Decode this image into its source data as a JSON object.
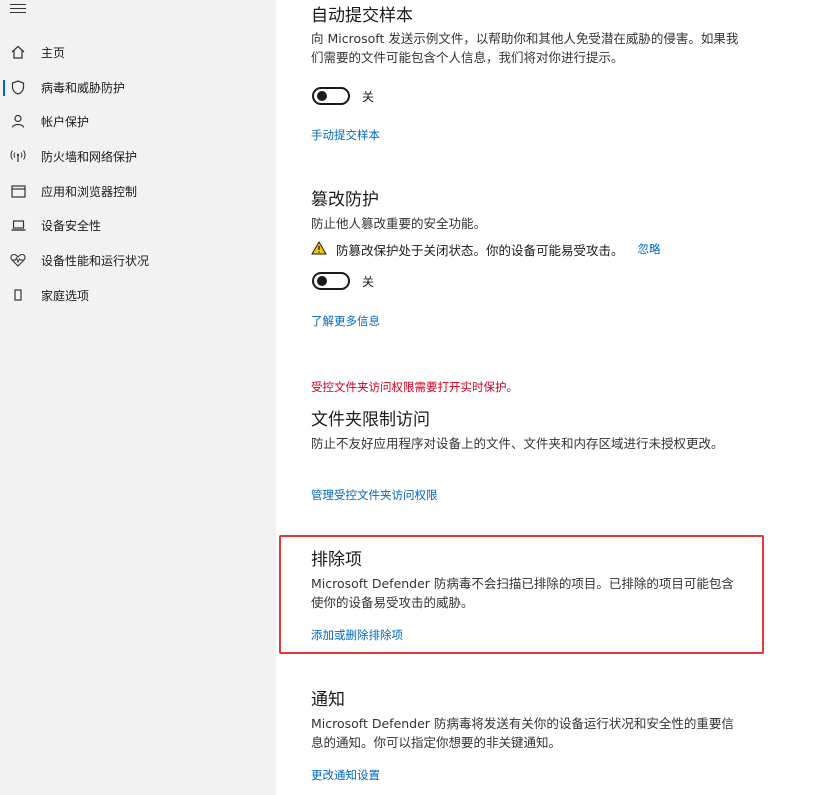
{
  "sidebar": {
    "menu_icon": "hamburger-icon",
    "items": [
      {
        "label": "主页",
        "icon": "home-icon"
      },
      {
        "label": "病毒和威胁防护",
        "icon": "shield-icon",
        "active": true
      },
      {
        "label": "帐户保护",
        "icon": "person-icon"
      },
      {
        "label": "防火墙和网络保护",
        "icon": "antenna-icon"
      },
      {
        "label": "应用和浏览器控制",
        "icon": "browser-window-icon"
      },
      {
        "label": "设备安全性",
        "icon": "laptop-icon"
      },
      {
        "label": "设备性能和运行状况",
        "icon": "heart-pulse-icon"
      },
      {
        "label": "家庭选项",
        "icon": "phone-icon"
      }
    ]
  },
  "sample_submission": {
    "title": "自动提交样本",
    "description": "向 Microsoft 发送示例文件，以帮助你和其他人免受潜在威胁的侵害。如果我们需要的文件可能包含个人信息，我们将对你进行提示。",
    "toggle_state": "关",
    "link": "手动提交样本"
  },
  "tamper_protection": {
    "title": "篡改防护",
    "description": "防止他人篡改重要的安全功能。",
    "warning_icon": "warning-triangle-icon",
    "warning_text": "防篡改保护处于关闭状态。你的设备可能易受攻击。",
    "dismiss_link": "忽略",
    "toggle_state": "关",
    "link": "了解更多信息"
  },
  "controlled_folder": {
    "note": "受控文件夹访问权限需要打开实时保护。",
    "title": "文件夹限制访问",
    "description": "防止不友好应用程序对设备上的文件、文件夹和内存区域进行未授权更改。",
    "link": "管理受控文件夹访问权限"
  },
  "exclusions": {
    "title": "排除项",
    "description": "Microsoft Defender 防病毒不会扫描已排除的项目。已排除的项目可能包含使你的设备易受攻击的威胁。",
    "link": "添加或删除排除项"
  },
  "notifications": {
    "title": "通知",
    "description": "Microsoft Defender 防病毒将发送有关你的设备运行状况和安全性的重要信息的通知。你可以指定你想要的非关键通知。",
    "link": "更改通知设置"
  },
  "colors": {
    "link": "#0067c0",
    "alert_red": "#d1001f",
    "highlight_border": "#e53935",
    "warning_yellow": "#f7c600"
  }
}
